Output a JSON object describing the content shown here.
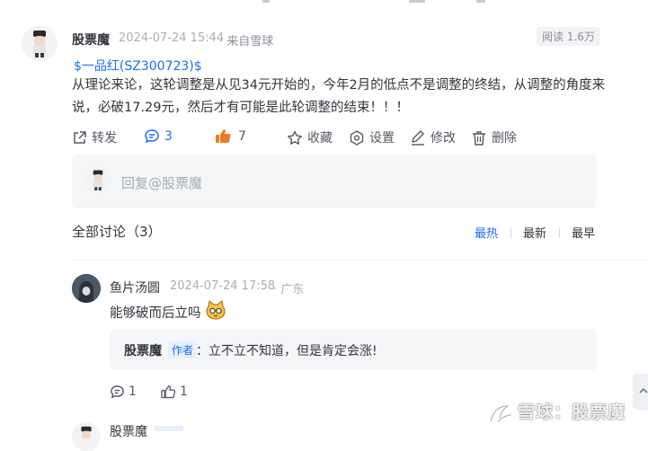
{
  "post": {
    "author": "股票魔",
    "time": "2024-07-24 15:44",
    "source": "· 来自雪球",
    "reads": "阅读 1.6万",
    "stock_link": "$一品红(SZ300723)$",
    "text": "从理论来论，这轮调整是从见34元开始的，今年2月的低点不是调整的终结，从调整的角度来说，必破17.29元，然后才有可能是此轮调整的结束！！！"
  },
  "actions": {
    "repost": "转发",
    "comments": "3",
    "likes": "7",
    "favorite": "收藏",
    "settings": "设置",
    "edit": "修改",
    "delete": "删除"
  },
  "reply": {
    "placeholder": "回复@股票魔"
  },
  "discussion": {
    "title": "全部讨论（3）",
    "sort": [
      "最热",
      "最新",
      "最早"
    ],
    "active_sort": "最热"
  },
  "comment1": {
    "name": "鱼片汤圆",
    "time": "2024-07-24 17:58",
    "location": "· 广东",
    "text": "能够破而后立吗",
    "reply_author": "股票魔",
    "reply_tag": "作者",
    "reply_text": "：立不立不知道，但是肯定会涨!",
    "comment_count": "1",
    "like_count": "1"
  },
  "comment2": {
    "name": "股票魔"
  },
  "watermark": "雪球：股票魔",
  "colors": {
    "accent": "#1a6ef5",
    "like": "#f07a20",
    "background": "#ffffff",
    "box": "#f5f6f8"
  }
}
